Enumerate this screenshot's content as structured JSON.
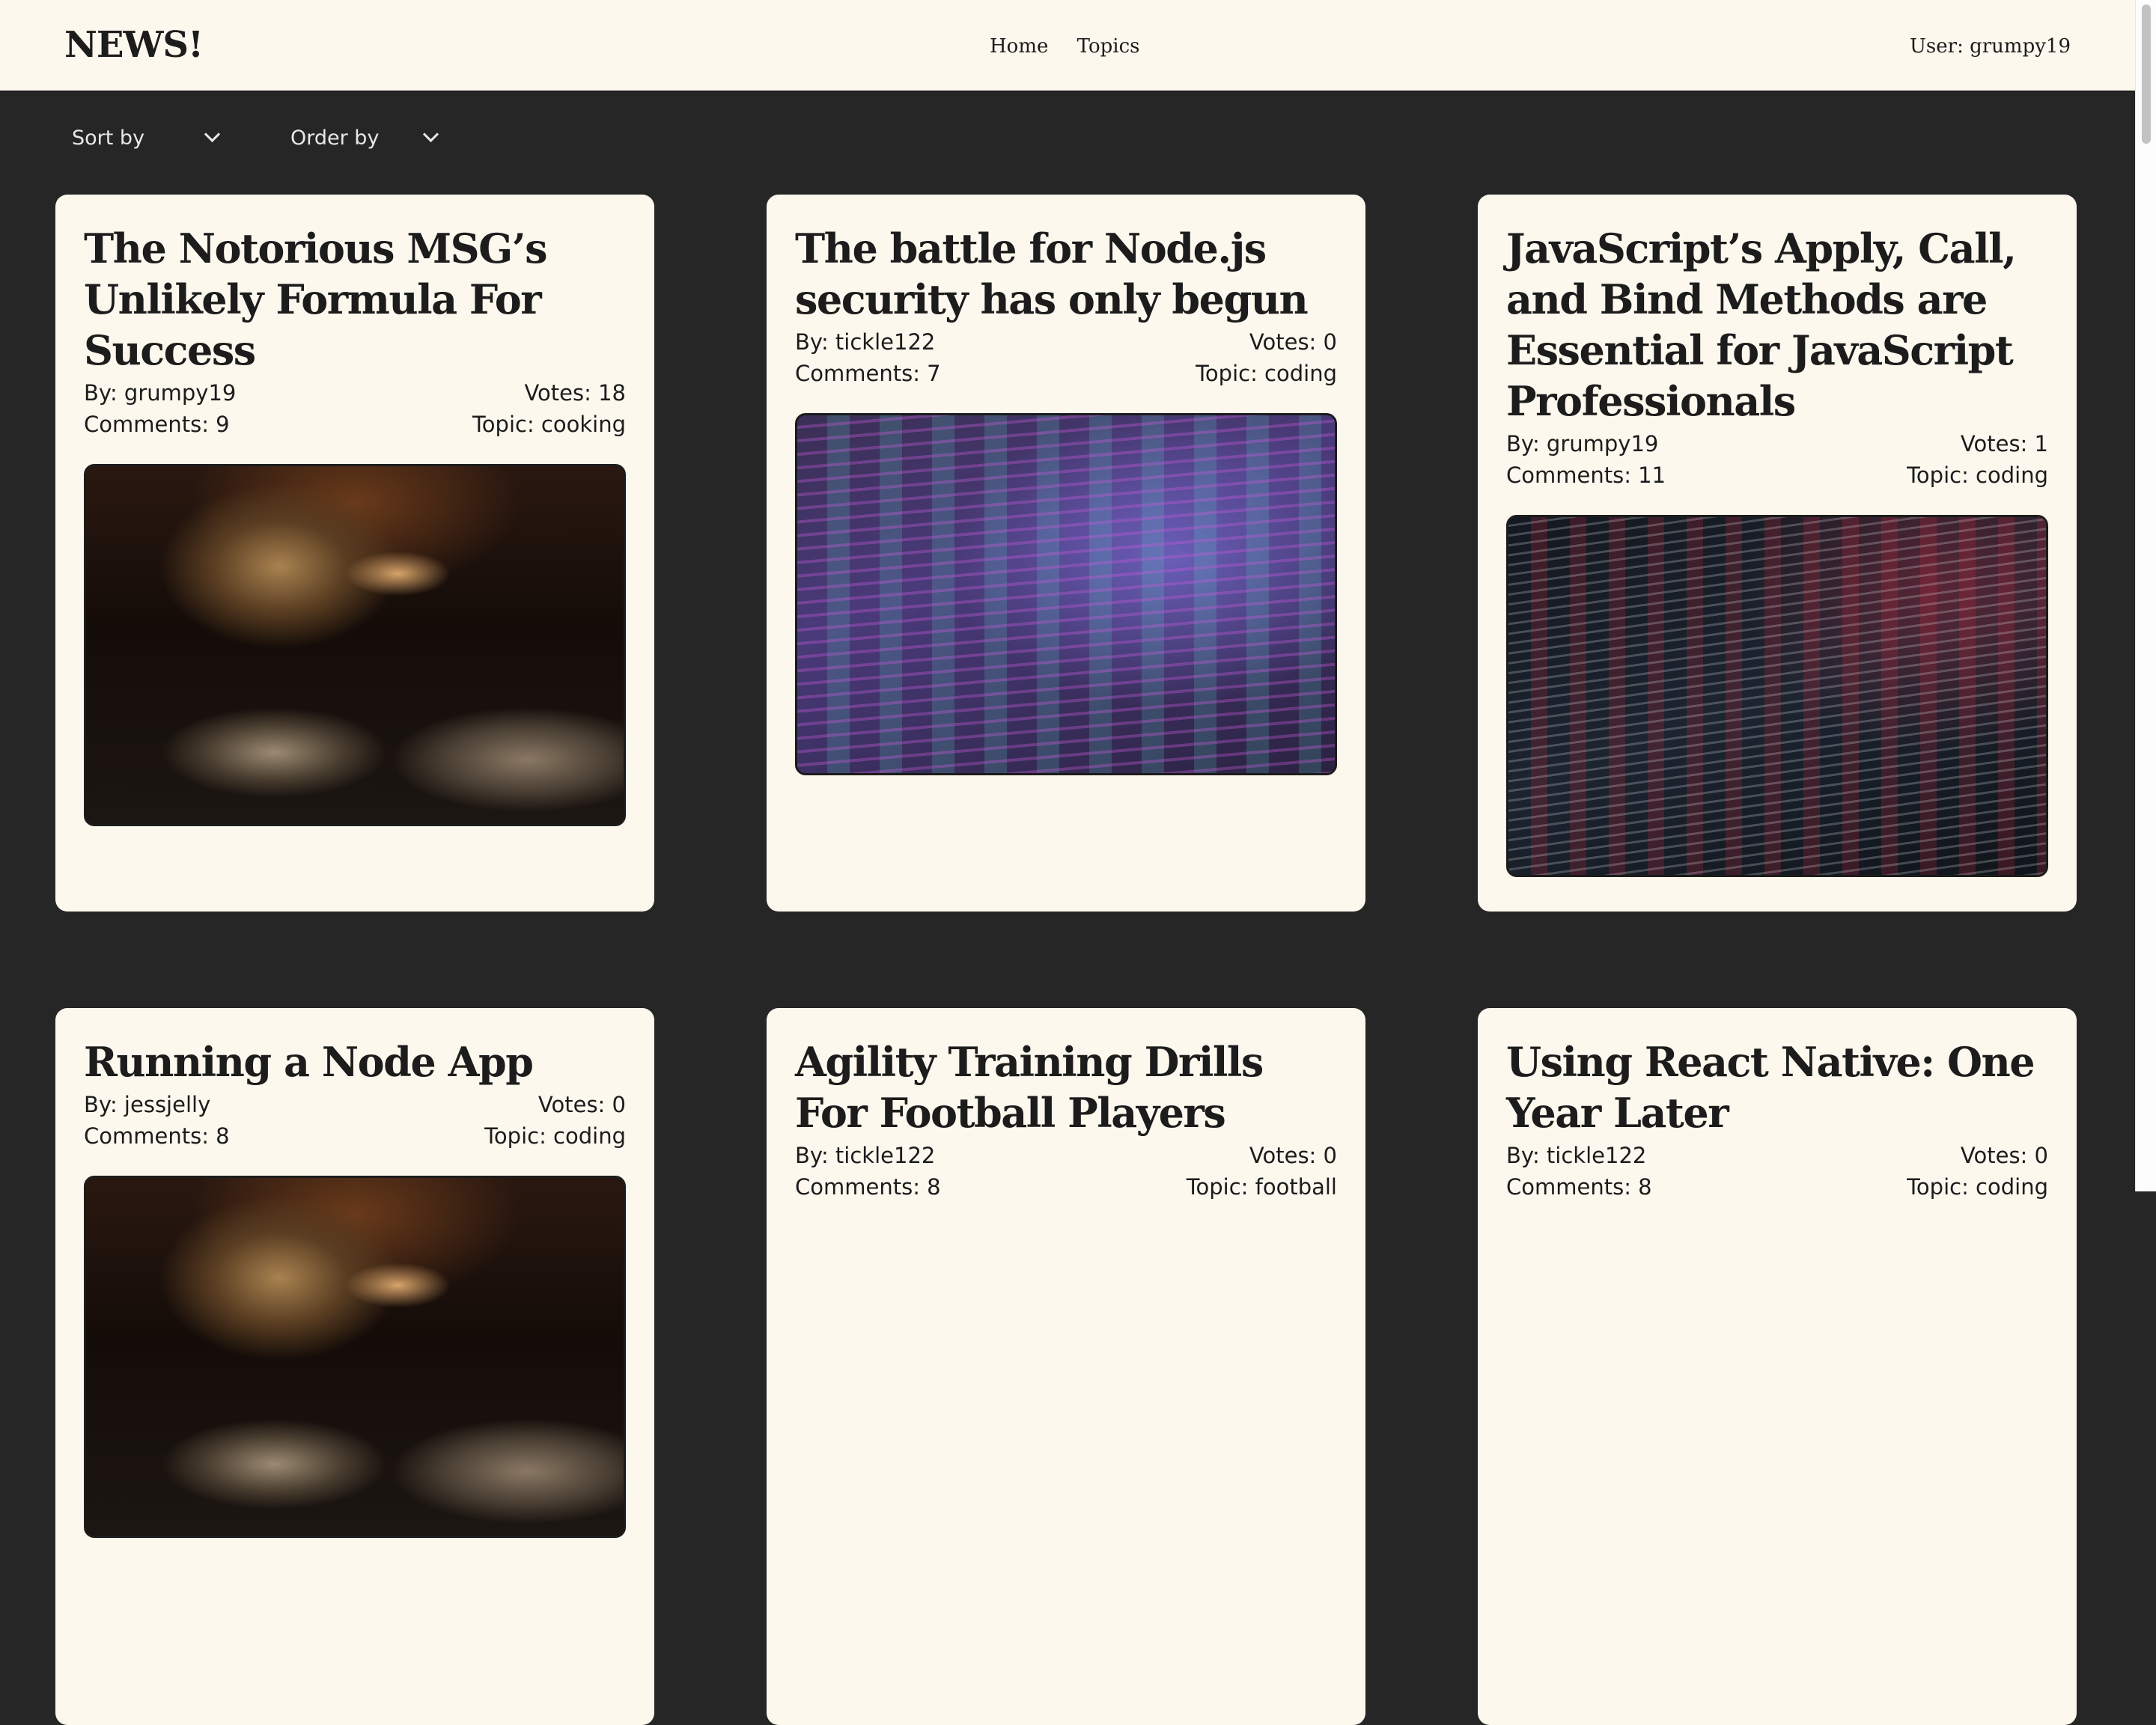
{
  "header": {
    "logo": "NEWS!",
    "nav": [
      "Home",
      "Topics"
    ],
    "user_label": "User: grumpy19"
  },
  "controls": {
    "sort_label": "Sort by",
    "order_label": "Order by"
  },
  "articles": [
    {
      "title": "The Notorious MSG’s Unlikely Formula For Success",
      "author": "By: grumpy19",
      "votes": "Votes: 18",
      "comments": "Comments: 9",
      "topic": "Topic: cooking"
    },
    {
      "title": "The battle for Node.js security has only begun",
      "author": "By: tickle122",
      "votes": "Votes: 0",
      "comments": "Comments: 7",
      "topic": "Topic: coding"
    },
    {
      "title": "JavaScript’s Apply, Call, and Bind Methods are Essential for JavaScript Professionals",
      "author": "By: grumpy19",
      "votes": "Votes: 1",
      "comments": "Comments: 11",
      "topic": "Topic: coding"
    },
    {
      "title": "Running a Node App",
      "author": "By: jessjelly",
      "votes": "Votes: 0",
      "comments": "Comments: 8",
      "topic": "Topic: coding"
    },
    {
      "title": "Agility Training Drills For Football Players",
      "author": "By: tickle122",
      "votes": "Votes: 0",
      "comments": "Comments: 8",
      "topic": "Topic: football"
    },
    {
      "title": "Using React Native: One Year Later",
      "author": "By: tickle122",
      "votes": "Votes: 0",
      "comments": "Comments: 8",
      "topic": "Topic: coding"
    }
  ],
  "colors": {
    "page_bg": "#262626",
    "card_bg": "#fdf8ee",
    "text": "#1c1c1c"
  }
}
